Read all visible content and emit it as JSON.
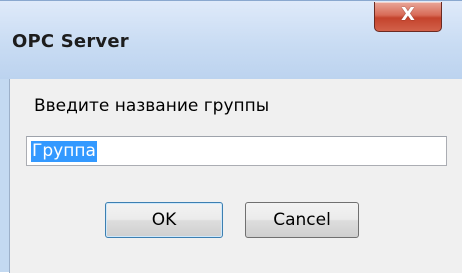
{
  "window": {
    "title": "OPC Server",
    "close_glyph": "X"
  },
  "dialog": {
    "prompt": "Введите название группы",
    "input_value": "Группа",
    "ok_label": "OK",
    "cancel_label": "Cancel"
  },
  "icons": {
    "close": "close-icon"
  },
  "colors": {
    "selection": "#3399ff",
    "close_button": "#c4432c",
    "titlebar": "#c9dcf3",
    "client": "#f0f0f0"
  }
}
